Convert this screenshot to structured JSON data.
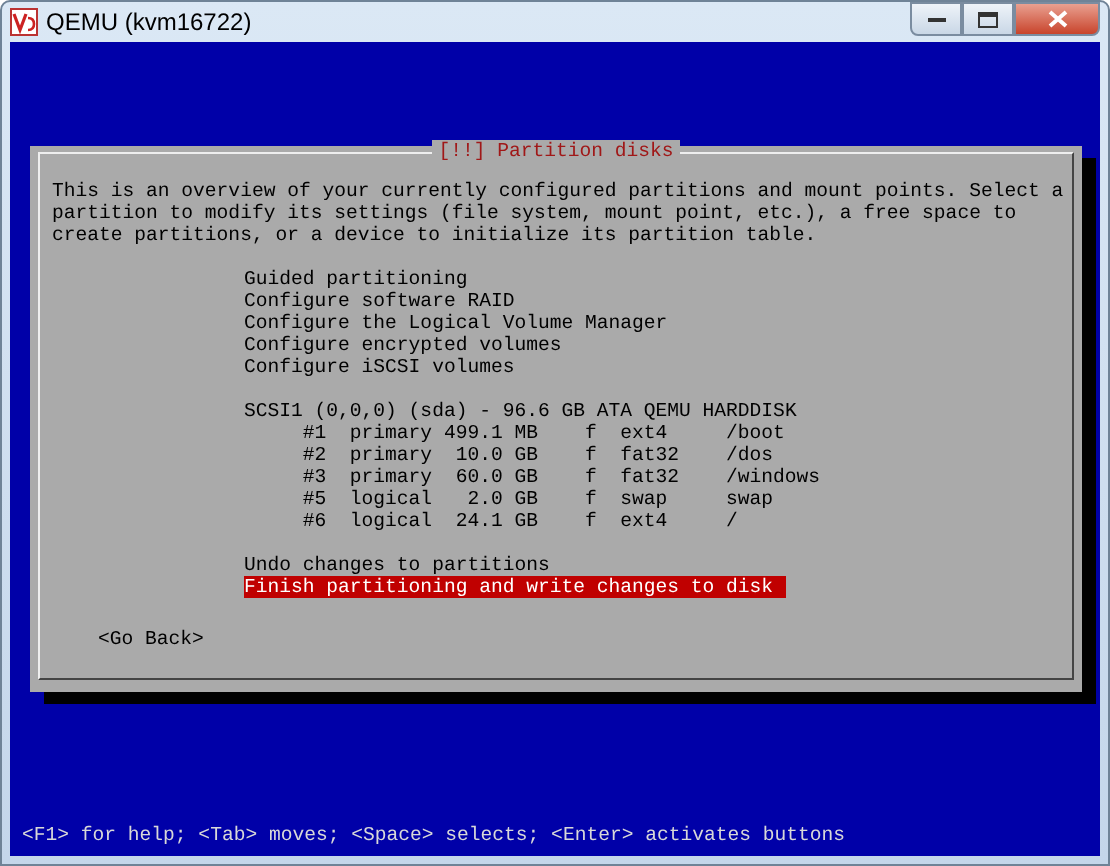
{
  "window": {
    "title": "QEMU (kvm16722)"
  },
  "dialog": {
    "title": "[!!] Partition disks",
    "description": "This is an overview of your currently configured partitions and mount points. Select a partition to modify its settings (file system, mount point, etc.), a free space to create partitions, or a device to initialize its partition table.",
    "items": [
      {
        "kind": "action",
        "label": "Guided partitioning",
        "selected": false
      },
      {
        "kind": "action",
        "label": "Configure software RAID",
        "selected": false
      },
      {
        "kind": "action",
        "label": "Configure the Logical Volume Manager",
        "selected": false
      },
      {
        "kind": "action",
        "label": "Configure encrypted volumes",
        "selected": false
      },
      {
        "kind": "action",
        "label": "Configure iSCSI volumes",
        "selected": false
      },
      {
        "kind": "spacer"
      },
      {
        "kind": "disk",
        "label": "SCSI1 (0,0,0) (sda) - 96.6 GB ATA QEMU HARDDISK",
        "selected": false
      },
      {
        "kind": "partition",
        "number": "#1",
        "type": "primary",
        "size": "499.1 MB",
        "flag": "f",
        "filesystem": "ext4",
        "mount": "/boot",
        "selected": false
      },
      {
        "kind": "partition",
        "number": "#2",
        "type": "primary",
        "size": "10.0 GB",
        "flag": "f",
        "filesystem": "fat32",
        "mount": "/dos",
        "selected": false
      },
      {
        "kind": "partition",
        "number": "#3",
        "type": "primary",
        "size": "60.0 GB",
        "flag": "f",
        "filesystem": "fat32",
        "mount": "/windows",
        "selected": false
      },
      {
        "kind": "partition",
        "number": "#5",
        "type": "logical",
        "size": "2.0 GB",
        "flag": "f",
        "filesystem": "swap",
        "mount": "swap",
        "selected": false
      },
      {
        "kind": "partition",
        "number": "#6",
        "type": "logical",
        "size": "24.1 GB",
        "flag": "f",
        "filesystem": "ext4",
        "mount": "/",
        "selected": false
      },
      {
        "kind": "spacer"
      },
      {
        "kind": "action",
        "label": "Undo changes to partitions",
        "selected": false
      },
      {
        "kind": "action",
        "label": "Finish partitioning and write changes to disk",
        "selected": true
      }
    ],
    "back_button": "<Go Back>"
  },
  "status_bar": "<F1> for help; <Tab> moves; <Space> selects; <Enter> activates buttons"
}
